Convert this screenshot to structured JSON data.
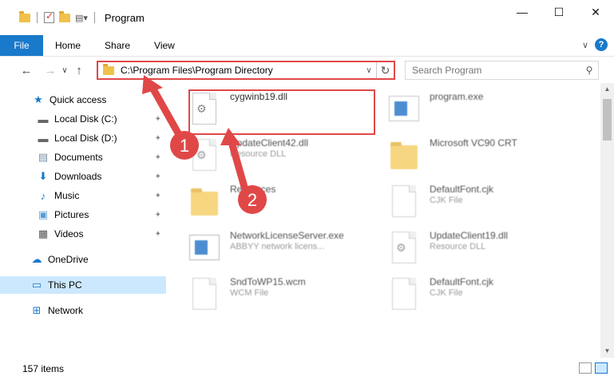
{
  "window": {
    "title": "Program",
    "minimize_glyph": "—",
    "maximize_glyph": "☐",
    "close_glyph": "✕"
  },
  "ribbon": {
    "tabs": [
      "File",
      "Home",
      "Share",
      "View"
    ],
    "collapse_glyph": "∨",
    "help_glyph": "?"
  },
  "nav": {
    "back_glyph": "←",
    "forward_glyph": "→",
    "recent_glyph": "∨",
    "up_glyph": "↑",
    "address": "C:\\Program Files\\Program Directory",
    "address_dropdown_glyph": "∨",
    "refresh_glyph": "↻",
    "search_placeholder": "Search Program",
    "search_glyph": "⚲"
  },
  "sidebar": {
    "items": [
      {
        "label": "Quick access",
        "icon": "star-icon"
      },
      {
        "label": "Local Disk (C:)",
        "icon": "drive-icon",
        "pinned": true
      },
      {
        "label": "Local Disk (D:)",
        "icon": "drive-icon",
        "pinned": true
      },
      {
        "label": "Documents",
        "icon": "documents-icon",
        "pinned": true
      },
      {
        "label": "Downloads",
        "icon": "downloads-icon",
        "pinned": true
      },
      {
        "label": "Music",
        "icon": "music-icon",
        "pinned": true
      },
      {
        "label": "Pictures",
        "icon": "pictures-icon",
        "pinned": true
      },
      {
        "label": "Videos",
        "icon": "videos-icon",
        "pinned": true
      },
      {
        "label": "OneDrive",
        "icon": "cloud-icon"
      },
      {
        "label": "This PC",
        "icon": "computer-icon",
        "selected": true
      },
      {
        "label": "Network",
        "icon": "network-icon"
      }
    ],
    "pin_glyph": "📌"
  },
  "files": [
    {
      "name": "cygwinb19.dll",
      "sub": "",
      "kind": "dll",
      "highlighted": true
    },
    {
      "name": "program.exe",
      "sub": "",
      "kind": "exe"
    },
    {
      "name": "UpdateClient42.dll",
      "sub": "Resource DLL",
      "kind": "dll"
    },
    {
      "name": "Microsoft VC90 CRT",
      "sub": "",
      "kind": "folder"
    },
    {
      "name": "Resources",
      "sub": "",
      "kind": "folder"
    },
    {
      "name": "DefaultFont.cjk",
      "sub": "CJK File",
      "kind": "doc"
    },
    {
      "name": "NetworkLicenseServer.exe",
      "sub": "ABBYY network licens...",
      "kind": "app"
    },
    {
      "name": "UpdateClient19.dll",
      "sub": "Resource DLL",
      "kind": "dll"
    },
    {
      "name": "SndToWP15.wcm",
      "sub": "WCM File",
      "kind": "doc"
    },
    {
      "name": "DefaultFont.cjk",
      "sub": "CJK File",
      "kind": "doc"
    }
  ],
  "annotations": {
    "marker1": "1",
    "marker2": "2",
    "color": "#e04848"
  },
  "status": {
    "items_count": "157 items"
  },
  "colors": {
    "accent": "#1979ca",
    "selection": "#cce8ff",
    "highlight": "#e04848"
  }
}
